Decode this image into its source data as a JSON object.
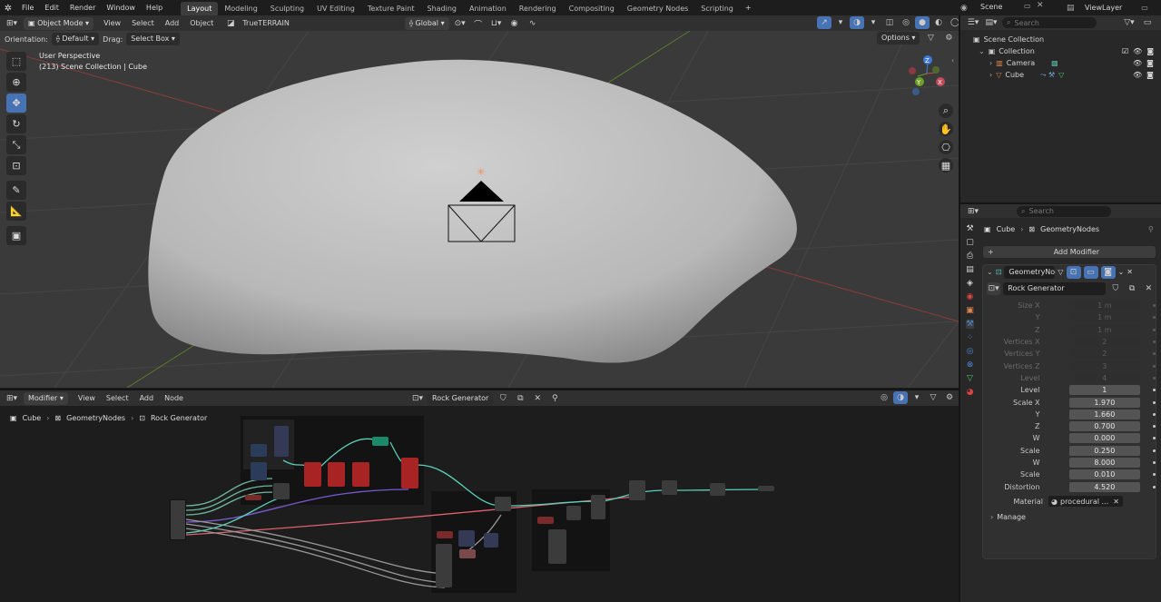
{
  "topbar": {
    "menus": [
      "File",
      "Edit",
      "Render",
      "Window",
      "Help"
    ],
    "workspaces": [
      "Layout",
      "Modeling",
      "Sculpting",
      "UV Editing",
      "Texture Paint",
      "Shading",
      "Animation",
      "Rendering",
      "Compositing",
      "Geometry Nodes",
      "Scripting"
    ],
    "active_workspace": "Layout",
    "add_tab": "+",
    "scene": "Scene",
    "view_layer": "ViewLayer"
  },
  "viewport_header": {
    "mode": "Object Mode",
    "menus": [
      "View",
      "Select",
      "Add",
      "Object"
    ],
    "addon": "TrueTERRAIN",
    "transform_orientation": "Global",
    "options": "Options",
    "orientation_label": "Orientation:",
    "orientation_value": "Default",
    "drag_label": "Drag:",
    "drag_value": "Select Box"
  },
  "viewport": {
    "perspective": "User Perspective",
    "collection_info": "(213) Scene Collection | Cube",
    "gizmo": {
      "x": "X",
      "y": "Y",
      "z": "Z"
    }
  },
  "node_editor_header": {
    "mode": "Modifier",
    "menus": [
      "View",
      "Select",
      "Add",
      "Node"
    ],
    "node_tree": "Rock Generator",
    "breadcrumb": [
      "Cube",
      "GeometryNodes",
      "Rock Generator"
    ]
  },
  "outliner": {
    "search_placeholder": "Search",
    "root": "Scene Collection",
    "collection": "Collection",
    "items": [
      "Camera",
      "Cube"
    ]
  },
  "properties": {
    "search_placeholder": "Search",
    "breadcrumb": [
      "Cube",
      "GeometryNodes"
    ],
    "add_modifier": "Add Modifier",
    "modifier_name": "GeometryNo...",
    "node_group": "Rock Generator",
    "rows": [
      {
        "label": "Size X",
        "value": "1 m",
        "dim": true
      },
      {
        "label": "Y",
        "value": "1 m",
        "dim": true
      },
      {
        "label": "Z",
        "value": "1 m",
        "dim": true
      },
      {
        "label": "Vertices X",
        "value": "2",
        "dim": true
      },
      {
        "label": "Vertices Y",
        "value": "2",
        "dim": true
      },
      {
        "label": "Vertices Z",
        "value": "3",
        "dim": true
      },
      {
        "label": "Level",
        "value": "4",
        "dim": true
      },
      {
        "label": "Level",
        "value": "1",
        "dim": false
      },
      {
        "label": "Scale X",
        "value": "1.970",
        "dim": false
      },
      {
        "label": "Y",
        "value": "1.660",
        "dim": false
      },
      {
        "label": "Z",
        "value": "0.700",
        "dim": false
      },
      {
        "label": "W",
        "value": "0.000",
        "dim": false
      },
      {
        "label": "Scale",
        "value": "0.250",
        "dim": false
      },
      {
        "label": "W",
        "value": "8.000",
        "dim": false
      },
      {
        "label": "Scale",
        "value": "0.010",
        "dim": false
      },
      {
        "label": "Distortion",
        "value": "4.520",
        "dim": false
      }
    ],
    "material_label": "Material",
    "material_value": "procedural ...",
    "manage": "Manage"
  }
}
